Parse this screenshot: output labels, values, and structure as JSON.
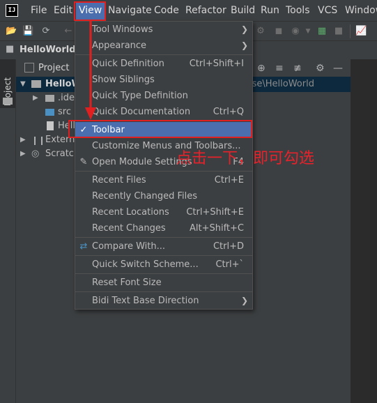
{
  "menubar": {
    "logo": "IJ",
    "items": [
      "File",
      "Edit",
      "View",
      "Navigate",
      "Code",
      "Refactor",
      "Build",
      "Run",
      "Tools",
      "VCS",
      "Window"
    ]
  },
  "navbar": {
    "project_name": "HelloWorld"
  },
  "panel": {
    "title": "Project",
    "stripe_label": "Project"
  },
  "tree": {
    "rows": [
      {
        "label": "HelloWorld",
        "path_hint": "ise\\HelloWorld"
      },
      {
        "label": ".idea"
      },
      {
        "label": "src"
      },
      {
        "label": "Hell"
      },
      {
        "label": "External"
      },
      {
        "label": "Scratch"
      }
    ]
  },
  "view_menu": {
    "items": [
      {
        "label": "Tool Windows",
        "shortcut": "",
        "submenu": true
      },
      {
        "label": "Appearance",
        "shortcut": "",
        "submenu": true
      },
      {
        "label": "Quick Definition",
        "shortcut": "Ctrl+Shift+I"
      },
      {
        "label": "Show Siblings",
        "shortcut": ""
      },
      {
        "label": "Quick Type Definition",
        "shortcut": ""
      },
      {
        "label": "Quick Documentation",
        "shortcut": "Ctrl+Q"
      },
      {
        "label": "Toolbar",
        "shortcut": "",
        "checked": true,
        "highlighted": true
      },
      {
        "label": "Customize Menus and Toolbars...",
        "shortcut": ""
      },
      {
        "label": "Open Module Settings",
        "shortcut": "F4"
      },
      {
        "label": "Recent Files",
        "shortcut": "Ctrl+E"
      },
      {
        "label": "Recently Changed Files",
        "shortcut": ""
      },
      {
        "label": "Recent Locations",
        "shortcut": "Ctrl+Shift+E"
      },
      {
        "label": "Recent Changes",
        "shortcut": "Alt+Shift+C"
      },
      {
        "label": "Compare With...",
        "shortcut": "Ctrl+D"
      },
      {
        "label": "Quick Switch Scheme...",
        "shortcut": "Ctrl+`"
      },
      {
        "label": "Reset Font Size",
        "shortcut": ""
      },
      {
        "label": "Bidi Text Base Direction",
        "shortcut": "",
        "submenu": true
      }
    ]
  },
  "annotation": {
    "text": "点击一下，即可勾选"
  },
  "colors": {
    "accent": "#4b6eaf",
    "annotation_red": "#e02020"
  }
}
